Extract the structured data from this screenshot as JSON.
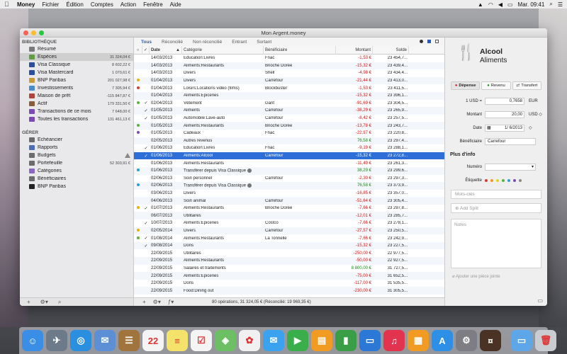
{
  "menubar": {
    "app": "Money",
    "items": [
      "Fichier",
      "Édition",
      "Comptes",
      "Action",
      "Fenêtre",
      "Aide"
    ],
    "clock": "Mar. 09:41"
  },
  "window": {
    "title": "Mon Argent.money"
  },
  "sidebar": {
    "section1": "BIBLIOTHÈQUE",
    "accounts": [
      {
        "label": "Résumé",
        "value": "",
        "icon": "summary-icon",
        "color": "#7a7a7a"
      },
      {
        "label": "Espèces",
        "value": "31 324,04 €",
        "icon": "cash-icon",
        "color": "#5f9e45",
        "selected": true
      },
      {
        "label": "Visa Classique",
        "value": "8 602,22 €",
        "icon": "card-icon",
        "color": "#2b4f9e"
      },
      {
        "label": "Visa Mastercard",
        "value": "1 070,61 €",
        "icon": "card-icon",
        "color": "#2b4f9e"
      },
      {
        "label": "BNP Paribas",
        "value": "201 027,98 €",
        "icon": "bank-icon",
        "color": "#c89a3b"
      },
      {
        "label": "Investissements",
        "value": "7 305,94 €",
        "icon": "investment-icon",
        "color": "#4a8ac9"
      },
      {
        "label": "Maison de prêt",
        "value": "-115 847,87 €",
        "icon": "loan-icon",
        "color": "#b0443a"
      },
      {
        "label": "Actif",
        "value": "179 331,50 €",
        "icon": "asset-icon",
        "color": "#8a5a3b"
      },
      {
        "label": "Transactions de ce mois",
        "value": "7 648,00 €",
        "icon": "smart-folder-icon",
        "color": "#7c49b5"
      },
      {
        "label": "Toutes les transactions",
        "value": "131 461,13 €",
        "icon": "smart-folder-icon",
        "color": "#7c49b5"
      }
    ],
    "section2": "GÉRER",
    "manage": [
      {
        "label": "Échéancier",
        "icon": "calendar-icon",
        "color": "#6b6b6b"
      },
      {
        "label": "Rapports",
        "icon": "reports-icon",
        "color": "#4a6fb5"
      },
      {
        "label": "Budgets",
        "icon": "budget-icon",
        "color": "#6b6b6b",
        "warn": true
      },
      {
        "label": "Portefeuille",
        "icon": "portfolio-icon",
        "color": "#6b6b6b",
        "value": "52 303,91 €"
      },
      {
        "label": "Catégories",
        "icon": "categories-icon",
        "color": "#8a67c4"
      },
      {
        "label": "Bénéficiaires",
        "icon": "payees-icon",
        "color": "#6b6b6b"
      },
      {
        "label": "BNP Paribas",
        "icon": "bank-icon",
        "color": "#222"
      }
    ]
  },
  "filters": [
    "Tous",
    "Réconcilié",
    "Non réconcilié",
    "Entrant",
    "Sortant"
  ],
  "columns": {
    "date": "Date",
    "category": "Catégorie",
    "payee": "Bénéficiaire",
    "amount": "Montant",
    "balance": "Solde"
  },
  "transactions": [
    {
      "dot": "",
      "check": "",
      "date": "14/03/2013",
      "category": "Éducation:Livres",
      "payee": "Fnac",
      "amount": "-1,53 €",
      "sign": "neg",
      "balance": "23 454,7..."
    },
    {
      "dot": "",
      "check": "",
      "date": "14/03/2013",
      "category": "Aliments:Restaurants",
      "payee": "Brioche Dorée",
      "amount": "-15,32 €",
      "sign": "neg",
      "balance": "23 439,4..."
    },
    {
      "dot": "",
      "check": "",
      "date": "14/03/2013",
      "category": "Divers",
      "payee": "Shell",
      "amount": "-4,98 €",
      "sign": "neg",
      "balance": "23 434,4..."
    },
    {
      "dot": "#e6b400",
      "check": "",
      "date": "01/04/2013",
      "category": "Divers",
      "payee": "Carrefour",
      "amount": "-21,44 €",
      "sign": "neg",
      "balance": "23 413,0..."
    },
    {
      "dot": "#d93a2f",
      "check": "",
      "date": "01/04/2013",
      "category": "Loisirs:Locations vidéo (films)",
      "payee": "Blockbuster",
      "amount": "-1,53 €",
      "sign": "neg",
      "balance": "23 411,5..."
    },
    {
      "dot": "",
      "check": "",
      "date": "01/04/2013",
      "category": "Aliments:Épiceries",
      "payee": "",
      "amount": "-15,32 €",
      "sign": "neg",
      "balance": "23 396,1..."
    },
    {
      "dot": "#5bb33a",
      "check": "✓",
      "date": "02/04/2013",
      "category": "Vêtement",
      "payee": "Gant",
      "amount": "-91,69 €",
      "sign": "neg",
      "balance": "23 304,5..."
    },
    {
      "dot": "",
      "check": "✓",
      "date": "01/05/2013",
      "category": "Aliments",
      "payee": "Carrefour",
      "amount": "-38,29 €",
      "sign": "neg",
      "balance": "23 265,9..."
    },
    {
      "dot": "",
      "check": "✓",
      "date": "01/05/2013",
      "category": "Automobile:Lave-auto",
      "payee": "Carrefour",
      "amount": "-8,42 €",
      "sign": "neg",
      "balance": "23 257,5..."
    },
    {
      "dot": "#5bb33a",
      "check": "",
      "date": "01/05/2013",
      "category": "Aliments:Restaurants",
      "payee": "Brioche Dorée",
      "amount": "-13,78 €",
      "sign": "neg",
      "balance": "23 243,7..."
    },
    {
      "dot": "#7c49b5",
      "check": "",
      "date": "01/05/2013",
      "category": "Cadeaux",
      "payee": "Fnac",
      "amount": "-22,97 €",
      "sign": "neg",
      "balance": "23 220,8..."
    },
    {
      "dot": "",
      "check": "",
      "date": "02/05/2013",
      "category": "Autres revenus",
      "payee": "",
      "amount": "76,58 €",
      "sign": "pos",
      "balance": "23 297,4..."
    },
    {
      "dot": "",
      "check": "✓",
      "date": "01/06/2013",
      "category": "Éducation:Livres",
      "payee": "Fnac",
      "amount": "-9,19 €",
      "sign": "neg",
      "balance": "23 288,1..."
    },
    {
      "dot": "",
      "check": "✓",
      "date": "01/06/2013",
      "category": "Aliments:Alcool",
      "payee": "Carrefour",
      "amount": "-15,32 €",
      "sign": "neg",
      "balance": "23 272,8...",
      "selected": true
    },
    {
      "dot": "",
      "check": "",
      "date": "01/06/2013",
      "category": "Aliments:Restaurants",
      "payee": "",
      "amount": "-11,49 €",
      "sign": "neg",
      "balance": "23 261,3..."
    },
    {
      "dot": "#2aa0d8",
      "check": "",
      "date": "01/06/2013",
      "category": "Transférer depuis Visa Classique",
      "payee": "",
      "amount": "38,29 €",
      "sign": "pos",
      "balance": "23 299,6...",
      "transfer": true
    },
    {
      "dot": "",
      "check": "",
      "date": "02/06/2013",
      "category": "Soin personnel",
      "payee": "Carrefour",
      "amount": "-2,30 €",
      "sign": "neg",
      "balance": "23 297,3..."
    },
    {
      "dot": "#2aa0d8",
      "check": "",
      "date": "02/06/2013",
      "category": "Transférer depuis Visa Classique",
      "payee": "",
      "amount": "76,58 €",
      "sign": "pos",
      "balance": "23 373,9...",
      "transfer": true
    },
    {
      "dot": "",
      "check": "",
      "date": "03/06/2013",
      "category": "Divers",
      "payee": "",
      "amount": "-16,85 €",
      "sign": "neg",
      "balance": "23 357,0..."
    },
    {
      "dot": "",
      "check": "",
      "date": "04/06/2013",
      "category": "Soin animal",
      "payee": "Carrefour",
      "amount": "-51,64 €",
      "sign": "neg",
      "balance": "23 305,4..."
    },
    {
      "dot": "#e6b400",
      "check": "✓",
      "date": "01/07/2013",
      "category": "Aliments:Restaurants",
      "payee": "Brioche Dorée",
      "amount": "-7,66 €",
      "sign": "neg",
      "balance": "23 297,8..."
    },
    {
      "dot": "",
      "check": "",
      "date": "06/07/2013",
      "category": "Utilitaires",
      "payee": "",
      "amount": "-12,01 €",
      "sign": "neg",
      "balance": "23 285,7..."
    },
    {
      "dot": "",
      "check": "✓",
      "date": "10/07/2013",
      "category": "Aliments:Épiceries",
      "payee": "Costco",
      "amount": "-7,66 €",
      "sign": "neg",
      "balance": "23 278,1..."
    },
    {
      "dot": "#e6b400",
      "check": "",
      "date": "02/05/2014",
      "category": "Divers",
      "payee": "Carrefour",
      "amount": "-27,57 €",
      "sign": "neg",
      "balance": "23 250,5..."
    },
    {
      "dot": "#5bb33a",
      "check": "✓",
      "date": "01/08/2014",
      "category": "Aliments:Restaurants",
      "payee": "La Tonnelle",
      "amount": "-7,66 €",
      "sign": "neg",
      "balance": "23 242,9..."
    },
    {
      "dot": "",
      "check": "✓",
      "date": "09/08/2014",
      "category": "Dons",
      "payee": "",
      "amount": "-15,32 €",
      "sign": "neg",
      "balance": "23 227,5..."
    },
    {
      "dot": "",
      "check": "",
      "date": "22/09/2015",
      "category": "Utilitaires",
      "payee": "",
      "amount": "-250,00 €",
      "sign": "neg",
      "balance": "22 977,5..."
    },
    {
      "dot": "",
      "check": "",
      "date": "22/09/2015",
      "category": "Aliments:Restaurants",
      "payee": "",
      "amount": "-50,00 €",
      "sign": "neg",
      "balance": "22 927,5..."
    },
    {
      "dot": "",
      "check": "",
      "date": "22/09/2015",
      "category": "Salaires et traitements",
      "payee": "",
      "amount": "8 800,00 €",
      "sign": "pos",
      "balance": "31 727,5..."
    },
    {
      "dot": "",
      "check": "",
      "date": "22/09/2015",
      "category": "Aliments:Épiceries",
      "payee": "",
      "amount": "-75,00 €",
      "sign": "neg",
      "balance": "31 652,5..."
    },
    {
      "dot": "",
      "check": "",
      "date": "22/09/2015",
      "category": "Dons",
      "payee": "",
      "amount": "-117,00 €",
      "sign": "neg",
      "balance": "31 535,5..."
    },
    {
      "dot": "",
      "check": "",
      "date": "22/09/2015",
      "category": "Food:Dining out",
      "payee": "",
      "amount": "-230,00 €",
      "sign": "neg",
      "balance": "31 305,5..."
    }
  ],
  "status": "80 opérations, 31 324,05 € (Réconcilié: 19 969,35 €)",
  "inspector": {
    "category_main": "Alcool",
    "category_parent": "Aliments",
    "types": [
      "Dépense",
      "Revenu",
      "Transfert"
    ],
    "rate_label": "1 USD =",
    "rate_value": "0,7658",
    "rate_currency": "EUR",
    "amount_label": "Montant",
    "amount_value": "20,00",
    "amount_currency": "USD",
    "date_label": "Date",
    "date_value": "1/  6/2013",
    "payee_label": "Bénéficiaire",
    "payee_value": "Carrefour",
    "more_info": "Plus d'info",
    "number_label": "Numéro",
    "label_label": "Étiquette",
    "label_colors": [
      "#d93a2f",
      "#f09a1a",
      "#e6d21a",
      "#5bb33a",
      "#2aa0d8",
      "#7c49b5",
      "#888888"
    ],
    "keywords_placeholder": "Mots-clés",
    "add_split": "Add Split",
    "notes_placeholder": "Notes",
    "attach": "Ajouter une pièce jointe"
  },
  "dock": [
    {
      "name": "finder-icon",
      "color": "#3a8ee6",
      "glyph": "☺"
    },
    {
      "name": "launchpad-icon",
      "color": "#6c7a8a",
      "glyph": "✈"
    },
    {
      "name": "safari-icon",
      "color": "#2b8fe0",
      "glyph": "◎"
    },
    {
      "name": "mail-icon",
      "color": "#5c8fd6",
      "glyph": "✉"
    },
    {
      "name": "contacts-icon",
      "color": "#a0743c",
      "glyph": "☰"
    },
    {
      "name": "calendar-icon",
      "color": "#f4f4f4",
      "glyph": "22"
    },
    {
      "name": "notes-icon",
      "color": "#f5e26a",
      "glyph": "≡"
    },
    {
      "name": "reminders-icon",
      "color": "#f4f4f4",
      "glyph": "☑"
    },
    {
      "name": "maps-icon",
      "color": "#6cbf63",
      "glyph": "◈"
    },
    {
      "name": "photos-icon",
      "color": "#f1f1f1",
      "glyph": "✿"
    },
    {
      "name": "messages-icon",
      "color": "#3ba2f0",
      "glyph": "✉"
    },
    {
      "name": "facetime-icon",
      "color": "#3aae4a",
      "glyph": "▶"
    },
    {
      "name": "ibooks-icon",
      "color": "#f29b23",
      "glyph": "▤"
    },
    {
      "name": "numbers-icon",
      "color": "#3a9e46",
      "glyph": "▮"
    },
    {
      "name": "keynote-icon",
      "color": "#2c78d6",
      "glyph": "▭"
    },
    {
      "name": "itunes-icon",
      "color": "#e2334f",
      "glyph": "♫"
    },
    {
      "name": "books-icon",
      "color": "#f29b23",
      "glyph": "▦"
    },
    {
      "name": "app-store-icon",
      "color": "#2d8fe6",
      "glyph": "A"
    },
    {
      "name": "system-preferences-icon",
      "color": "#7d7d83",
      "glyph": "⚙"
    },
    {
      "name": "money-app-icon",
      "color": "#4a3224",
      "glyph": "¤"
    },
    {
      "name": "downloads-folder-icon",
      "color": "#5da7e8",
      "glyph": "▭"
    },
    {
      "name": "trash-icon",
      "color": "#c9ccd1",
      "glyph": "🗑"
    }
  ]
}
